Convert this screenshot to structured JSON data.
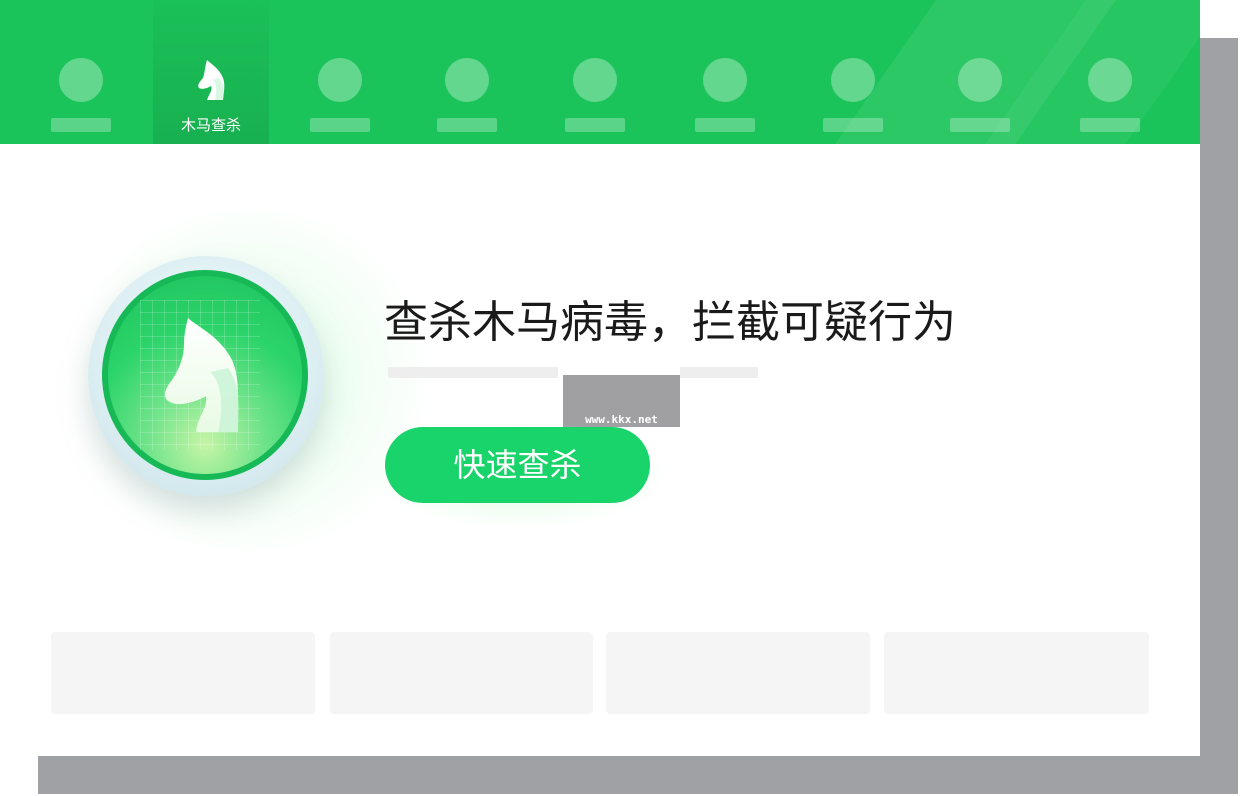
{
  "nav": {
    "tabs": [
      {
        "label": "",
        "active": false
      },
      {
        "label": "木马查杀",
        "active": true,
        "icon": "horse-icon"
      },
      {
        "label": "",
        "active": false
      },
      {
        "label": "",
        "active": false
      },
      {
        "label": "",
        "active": false
      },
      {
        "label": "",
        "active": false
      },
      {
        "label": "",
        "active": false
      },
      {
        "label": "",
        "active": false
      },
      {
        "label": "",
        "active": false
      }
    ]
  },
  "hero": {
    "headline": "查杀木马病毒，拦截可疑行为",
    "scan_button_label": "快速查杀",
    "icon": "horse-shield-icon"
  },
  "watermark": {
    "text": "www.kkx.net"
  },
  "colors": {
    "brand_green": "#1bc45a",
    "button_green": "#19d36b",
    "frame_gray": "#9fa1a4"
  }
}
